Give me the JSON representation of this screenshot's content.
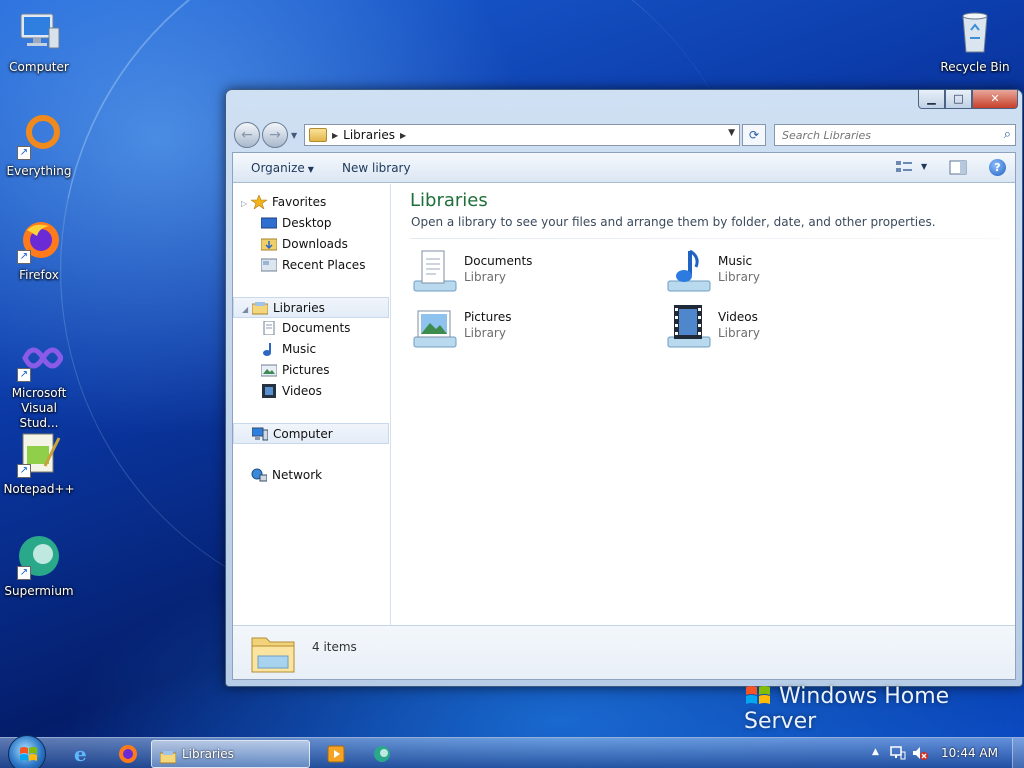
{
  "desktop": {
    "icons": [
      {
        "label": "Computer",
        "icon": "computer-icon"
      },
      {
        "label": "Everything",
        "icon": "everything-icon"
      },
      {
        "label": "Firefox",
        "icon": "firefox-icon"
      },
      {
        "label": "Microsoft Visual Stud...",
        "icon": "visual-studio-icon"
      },
      {
        "label": "Notepad++",
        "icon": "notepad-plus-plus-icon"
      },
      {
        "label": "Supermium",
        "icon": "supermium-icon"
      },
      {
        "label": "Recycle Bin",
        "icon": "recycle-bin-icon"
      }
    ],
    "branding": "Windows Home Server"
  },
  "window": {
    "address": {
      "crumb": "Libraries"
    },
    "search": {
      "placeholder": "Search Libraries"
    },
    "toolbar": {
      "organize": "Organize",
      "new_library": "New library"
    },
    "nav": {
      "favorites": "Favorites",
      "favorites_items": [
        "Desktop",
        "Downloads",
        "Recent Places"
      ],
      "libraries": "Libraries",
      "libraries_items": [
        "Documents",
        "Music",
        "Pictures",
        "Videos"
      ],
      "computer": "Computer",
      "network": "Network"
    },
    "main": {
      "title": "Libraries",
      "subtitle": "Open a library to see your files and arrange them by folder, date, and other properties.",
      "items": [
        {
          "name": "Documents",
          "type": "Library"
        },
        {
          "name": "Music",
          "type": "Library"
        },
        {
          "name": "Pictures",
          "type": "Library"
        },
        {
          "name": "Videos",
          "type": "Library"
        }
      ]
    },
    "details": {
      "count": "4 items"
    }
  },
  "taskbar": {
    "active_window": "Libraries",
    "clock": "10:44 AM"
  },
  "colors": {
    "title_green": "#1f6f3a",
    "accent_blue": "#1e5fbf",
    "close_red": "#c7402a"
  }
}
